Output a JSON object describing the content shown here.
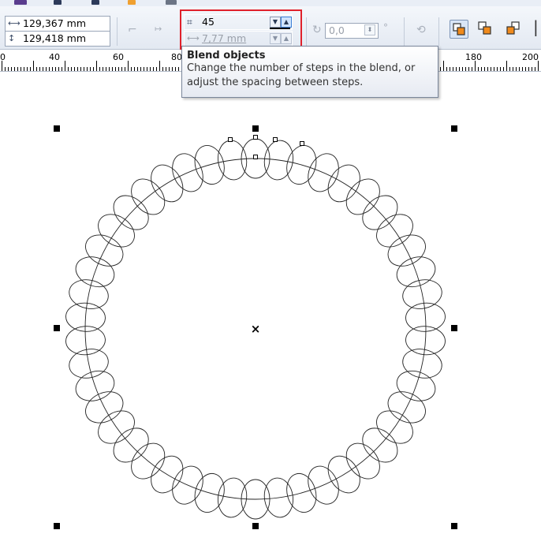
{
  "object_size": {
    "width": "129,367 mm",
    "height": "129,418 mm"
  },
  "blend": {
    "steps_value": "45",
    "spacing_value": "7,77 mm",
    "direction_value": "0,0",
    "degree_symbol": "°"
  },
  "tooltip": {
    "title": "Blend objects",
    "line1": "Change the number of steps in the blend, or",
    "line2": "adjust the spacing between steps."
  },
  "ruler": {
    "labels": [
      "0",
      "40",
      "60",
      "80",
      "180",
      "200"
    ]
  },
  "colors": {
    "highlight": "#e0212b",
    "toolbar_bg": "#e3e9f2",
    "orange_icon": "#f08a1c"
  },
  "icons": {
    "width": "width-arrows-icon",
    "height": "height-arrows-icon",
    "steps": "blend-steps-icon",
    "spacing": "blend-spacing-icon",
    "direction": "blend-direction-icon"
  }
}
